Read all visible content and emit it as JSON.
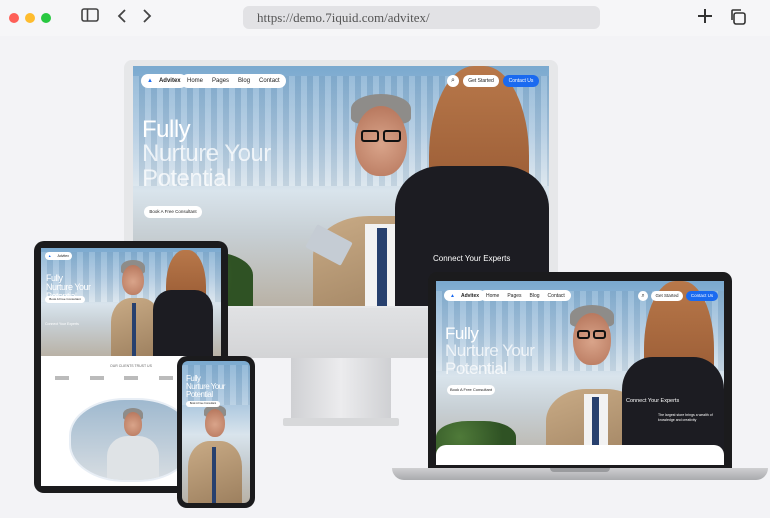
{
  "browser": {
    "url": "https://demo.7iquid.com/advitex/",
    "icons": {
      "sidebar": "sidebar-icon",
      "back": "chevron-left-icon",
      "forward": "chevron-right-icon",
      "new_tab": "plus-icon",
      "tabs": "copy-icon"
    }
  },
  "site": {
    "brand": "Advitex",
    "nav": [
      "Home",
      "Pages",
      "Blog",
      "Contact"
    ],
    "get_started": "Get Started",
    "contact_us": "Contact Us",
    "hero_line1": "Fully",
    "hero_line2": "Nurture Your",
    "hero_line3": "Potential",
    "cta": "Book A Free Consultant",
    "connect": "Connect Your Experts",
    "connect_sub": "The largest store brings a wealth of knowledge and creativity",
    "trust_heading": "OUR CLIENTS TRUST US"
  },
  "colors": {
    "accent": "#1a6af0",
    "page_bg": "#f3f3f6"
  }
}
